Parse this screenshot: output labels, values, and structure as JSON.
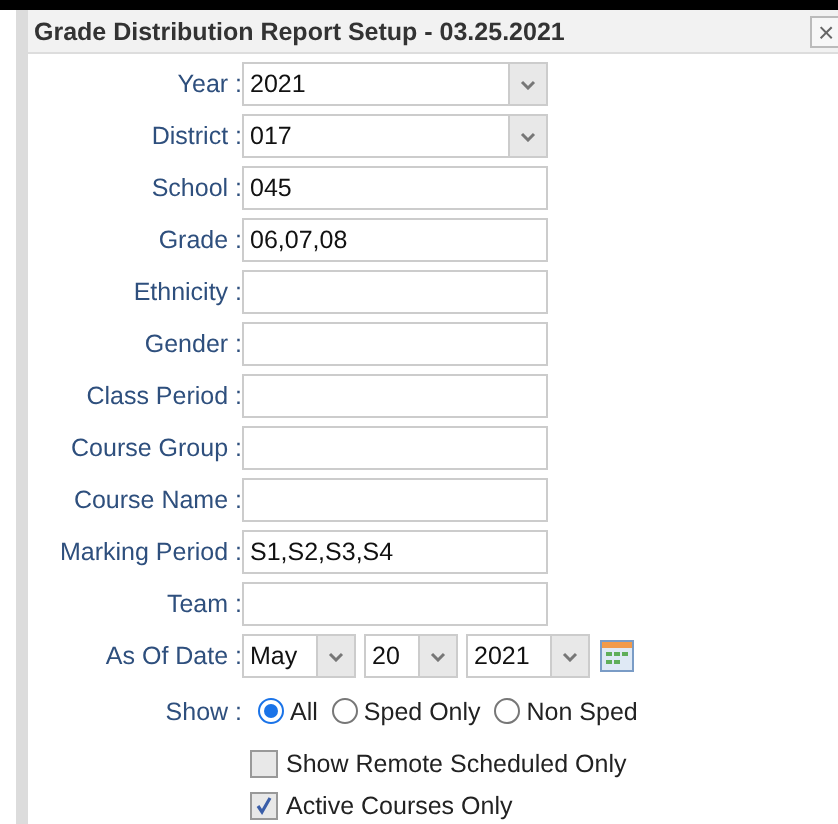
{
  "window": {
    "title": "Grade Distribution Report Setup - 03.25.2021",
    "close": "×"
  },
  "fields": [
    {
      "label": "Year :",
      "kind": "select",
      "value": "2021"
    },
    {
      "label": "District :",
      "kind": "select",
      "value": "017"
    },
    {
      "label": "School :",
      "kind": "text",
      "value": "045"
    },
    {
      "label": "Grade :",
      "kind": "text",
      "value": "06,07,08"
    },
    {
      "label": "Ethnicity :",
      "kind": "text"
    },
    {
      "label": "Gender :",
      "kind": "text"
    },
    {
      "label": "Class Period :",
      "kind": "text"
    },
    {
      "label": "Course Group :",
      "kind": "text"
    },
    {
      "label": "Course Name :",
      "kind": "text"
    },
    {
      "label": "Marking Period :",
      "kind": "text",
      "value": "S1,S2,S3,S4"
    },
    {
      "label": "Team :",
      "kind": "text"
    }
  ],
  "as_of_date": {
    "label": "As Of Date :",
    "parts": [
      "May",
      "20",
      "2021"
    ]
  },
  "show": {
    "label": "Show :",
    "options": [
      {
        "label": "All",
        "selected": true
      },
      {
        "label": "Sped Only",
        "selected": false
      },
      {
        "label": "Non Sped",
        "selected": false
      }
    ]
  },
  "checkboxes": [
    {
      "label": "Show Remote Scheduled Only",
      "checked": false
    },
    {
      "label": "Active Courses Only",
      "checked": true
    }
  ]
}
